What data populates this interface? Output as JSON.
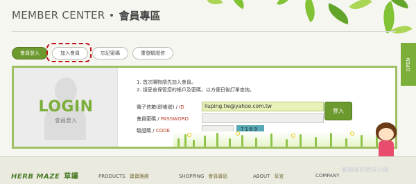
{
  "header": {
    "title_en": "MEMBER CENTER",
    "title_zh": "會員專區"
  },
  "tabs": [
    {
      "label": "會員登入",
      "active": true
    },
    {
      "label": "加入會員",
      "active": false
    },
    {
      "label": "忘記密碼",
      "active": false
    },
    {
      "label": "重發驗證信",
      "active": false
    }
  ],
  "side_panel": {
    "open_label": "OPEN",
    "promo_line1": "全館",
    "promo_line2": "新$"
  },
  "login": {
    "title": "LOGIN",
    "subtitle": "會員登入",
    "instructions": [
      "1. 首次購物請先加入會員。",
      "2. 請妥善保管您的帳戶及密碼，以方便日後訂單查詢。"
    ],
    "email_label": "電子信箱(即帳號) /",
    "email_label_en": "ID",
    "email_value": "liuping.tw@yahoo.com.tw",
    "password_label": "會員密碼 /",
    "password_label_en": "PASSWORD",
    "captcha_label": "驗證碼 /",
    "captcha_label_en": "CODE",
    "captcha_text": "7169",
    "submit_label": "登入"
  },
  "footer": {
    "brand_en": "HERB MAZE",
    "brand_zh": "草鑼",
    "nav": [
      {
        "en": "PRODUCTS",
        "zh": "寶寶護膚"
      },
      {
        "en": "SHOPPING",
        "zh": "會員專區"
      },
      {
        "en": "ABOUT",
        "zh": "草宣"
      },
      {
        "en": "COMPANY",
        "zh": ""
      }
    ],
    "watermark": "劉圓圓的我是小圓"
  },
  "colors": {
    "accent": "#6d9a2f",
    "highlight": "#c0121a",
    "panel_border": "#9fbf62"
  }
}
